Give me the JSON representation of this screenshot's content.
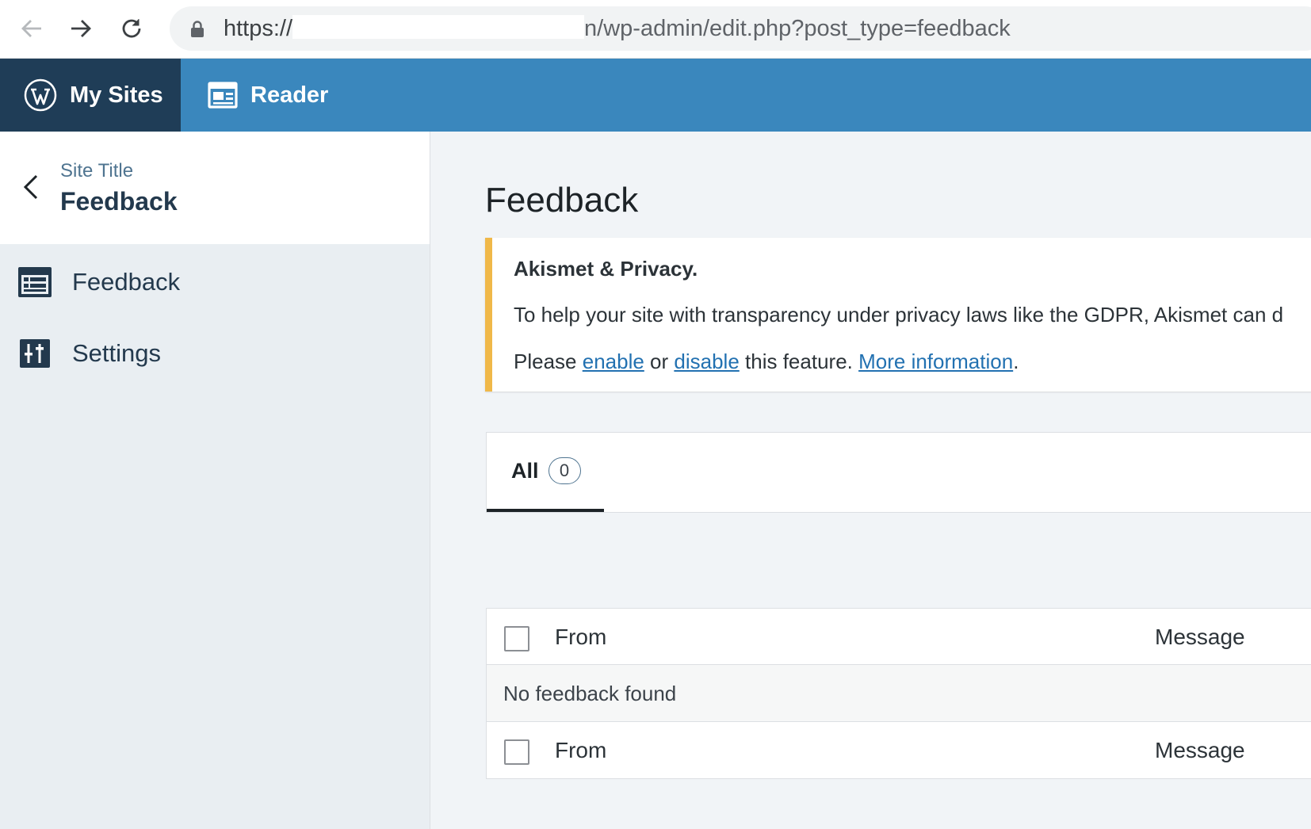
{
  "browser": {
    "url_protocol": "https://",
    "url_path": "n/wp-admin/edit.php?post_type=feedback"
  },
  "masterbar": {
    "my_sites": "My Sites",
    "reader": "Reader"
  },
  "sidebar": {
    "site_title": "Site Title",
    "section_title": "Feedback",
    "items": [
      {
        "label": "Feedback",
        "icon": "feedback-icon"
      },
      {
        "label": "Settings",
        "icon": "settings-sliders-icon"
      }
    ]
  },
  "main": {
    "page_title": "Feedback",
    "notice": {
      "title": "Akismet & Privacy.",
      "body": "To help your site with transparency under privacy laws like the GDPR, Akismet can d",
      "please": "Please ",
      "enable": "enable",
      "or": " or ",
      "disable": "disable",
      "this_feature": " this feature. ",
      "more_info": "More information",
      "period": "."
    },
    "tabs": [
      {
        "label": "All",
        "count": "0"
      }
    ],
    "table": {
      "columns": [
        "From",
        "Message"
      ],
      "empty_message": "No feedback found"
    }
  },
  "colors": {
    "masterbar": "#3a87bd",
    "masterbar_active": "#1f3d57",
    "notice_accent": "#f0b849",
    "link": "#2271b1"
  }
}
